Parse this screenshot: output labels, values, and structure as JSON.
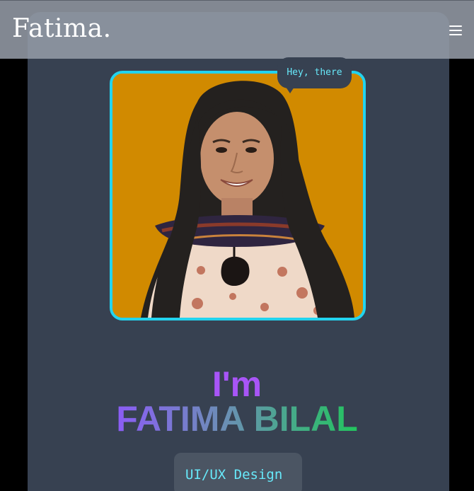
{
  "navbar": {
    "brand": "Fatima.",
    "menu_icon": "hamburger-menu-icon"
  },
  "hero": {
    "greeting_bubble": "Hey, there",
    "photo_alt": "Portrait of Fatima Bilal",
    "intro": "I'm",
    "name": "FATIMA BILAL",
    "role": "UI/UX Design"
  },
  "colors": {
    "page_background": "#000000",
    "card_background": "#374151",
    "navbar_background": "#949ba6",
    "accent_cyan": "#22d3ee",
    "photo_background": "#d18a00",
    "intro_purple": "#a855f7",
    "name_gradient_start": "#8b5cf6",
    "name_gradient_end": "#22c55e",
    "role_box_background": "#4b5563"
  }
}
